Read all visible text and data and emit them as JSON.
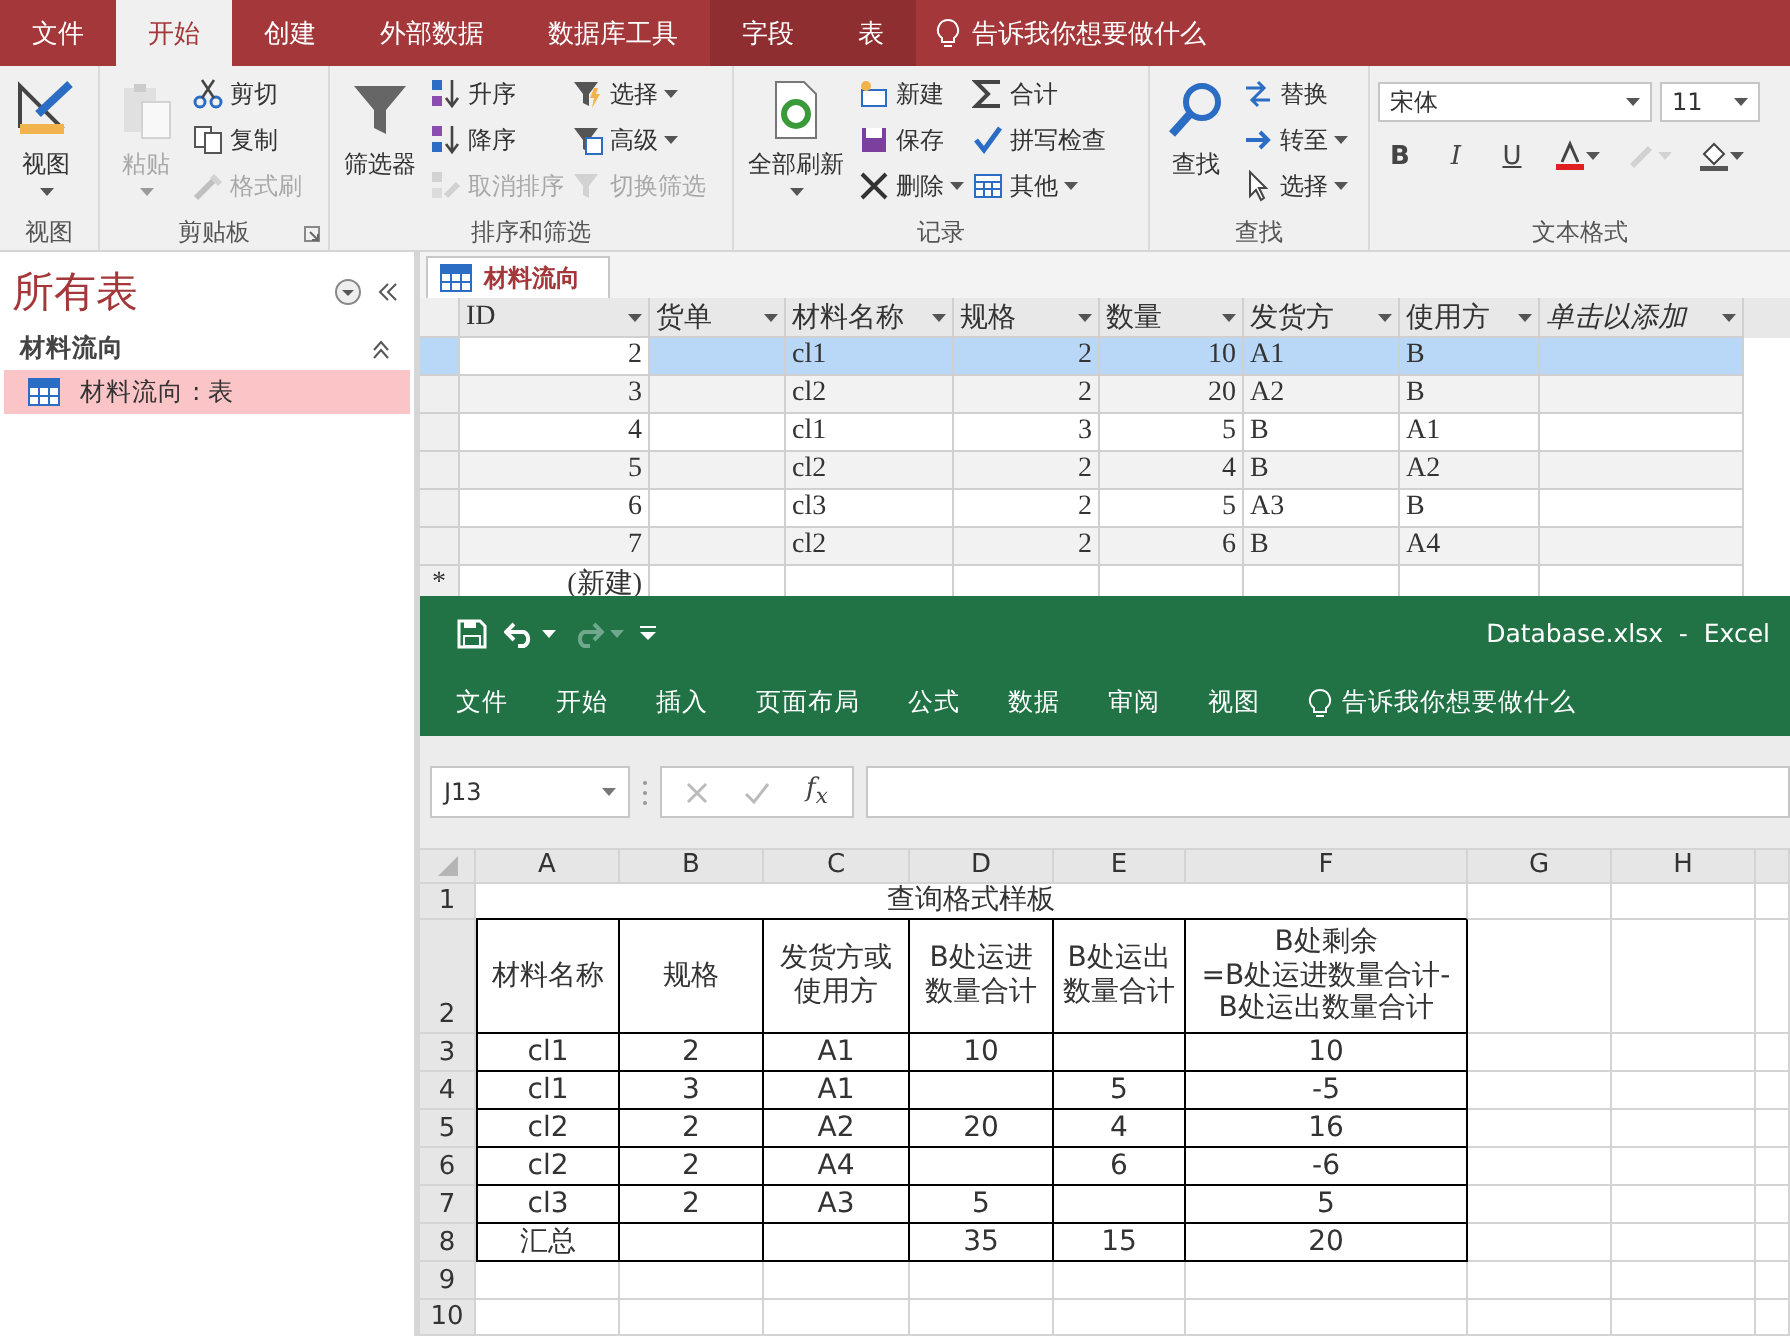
{
  "access": {
    "tabs": [
      {
        "label": "文件",
        "selected": false,
        "contextual": false
      },
      {
        "label": "开始",
        "selected": true,
        "contextual": false
      },
      {
        "label": "创建",
        "selected": false,
        "contextual": false
      },
      {
        "label": "外部数据",
        "selected": false,
        "contextual": false
      },
      {
        "label": "数据库工具",
        "selected": false,
        "contextual": false
      },
      {
        "label": "字段",
        "selected": false,
        "contextual": true
      },
      {
        "label": "表",
        "selected": false,
        "contextual": true
      }
    ],
    "tell_me": "告诉我你想要做什么",
    "ribbon": [
      {
        "label": "视图",
        "launcher": false,
        "columns": [
          [
            {
              "label": "视图",
              "kind": "large",
              "dropdown": true,
              "disabled": false
            }
          ]
        ]
      },
      {
        "label": "剪贴板",
        "launcher": true,
        "columns": [
          [
            {
              "label": "粘贴",
              "kind": "large",
              "dropdown": true,
              "disabled": true
            }
          ],
          [
            {
              "label": "剪切",
              "kind": "small",
              "dropdown": false,
              "disabled": false
            },
            {
              "label": "复制",
              "kind": "small",
              "dropdown": false,
              "disabled": false
            },
            {
              "label": "格式刷",
              "kind": "small",
              "dropdown": false,
              "disabled": true
            }
          ]
        ]
      },
      {
        "label": "排序和筛选",
        "launcher": false,
        "columns": [
          [
            {
              "label": "筛选器",
              "kind": "large",
              "dropdown": false,
              "disabled": false
            }
          ],
          [
            {
              "label": "升序",
              "kind": "small",
              "dropdown": false,
              "disabled": false
            },
            {
              "label": "降序",
              "kind": "small",
              "dropdown": false,
              "disabled": false
            },
            {
              "label": "取消排序",
              "kind": "small",
              "dropdown": false,
              "disabled": true
            }
          ],
          [
            {
              "label": "选择",
              "kind": "small",
              "dropdown": true,
              "disabled": false
            },
            {
              "label": "高级",
              "kind": "small",
              "dropdown": true,
              "disabled": false
            },
            {
              "label": "切换筛选",
              "kind": "small",
              "dropdown": false,
              "disabled": true
            }
          ]
        ]
      },
      {
        "label": "记录",
        "launcher": false,
        "columns": [
          [
            {
              "label": "全部刷新",
              "kind": "large",
              "dropdown": true,
              "disabled": false
            }
          ],
          [
            {
              "label": "新建",
              "kind": "small",
              "dropdown": false,
              "disabled": false
            },
            {
              "label": "保存",
              "kind": "small",
              "dropdown": false,
              "disabled": false
            },
            {
              "label": "删除",
              "kind": "small",
              "dropdown": true,
              "disabled": false
            }
          ],
          [
            {
              "label": "合计",
              "kind": "small",
              "dropdown": false,
              "disabled": false
            },
            {
              "label": "拼写检查",
              "kind": "small",
              "dropdown": false,
              "disabled": false
            },
            {
              "label": "其他",
              "kind": "small",
              "dropdown": true,
              "disabled": false
            }
          ]
        ]
      },
      {
        "label": "查找",
        "launcher": false,
        "columns": [
          [
            {
              "label": "查找",
              "kind": "large",
              "dropdown": false,
              "disabled": false
            }
          ],
          [
            {
              "label": "替换",
              "kind": "small",
              "dropdown": false,
              "disabled": false
            },
            {
              "label": "转至",
              "kind": "small",
              "dropdown": true,
              "disabled": false
            },
            {
              "label": "选择",
              "kind": "small",
              "dropdown": true,
              "disabled": false
            }
          ]
        ]
      }
    ],
    "text_format": {
      "label": "文本格式",
      "font": "宋体",
      "size": "11",
      "style_buttons": [
        {
          "label": "B",
          "kind": "bold"
        },
        {
          "label": "I",
          "kind": "italic"
        },
        {
          "label": "U",
          "kind": "underline"
        }
      ]
    },
    "nav": {
      "title": "所有表",
      "groups": [
        {
          "label": "材料流向",
          "expanded": true,
          "items": [
            {
              "label": "材料流向 : 表",
              "selected": true
            }
          ]
        }
      ]
    },
    "document_tabs": [
      {
        "label": "材料流向",
        "selected": true
      }
    ],
    "datasheet": {
      "columns": [
        {
          "label": "ID",
          "kind": "number"
        },
        {
          "label": "货单",
          "kind": "text"
        },
        {
          "label": "材料名称",
          "kind": "text"
        },
        {
          "label": "规格",
          "kind": "number"
        },
        {
          "label": "数量",
          "kind": "number"
        },
        {
          "label": "发货方",
          "kind": "text"
        },
        {
          "label": "使用方",
          "kind": "text"
        },
        {
          "label": "单击以添加",
          "kind": "add"
        }
      ],
      "rows": [
        {
          "selected": true,
          "cells": [
            "2",
            null,
            "cl1",
            "2",
            "10",
            "A1",
            "B",
            null
          ]
        },
        {
          "selected": false,
          "cells": [
            "3",
            null,
            "cl2",
            "2",
            "20",
            "A2",
            "B",
            null
          ]
        },
        {
          "selected": false,
          "cells": [
            "4",
            null,
            "cl1",
            "3",
            "5",
            "B",
            "A1",
            null
          ]
        },
        {
          "selected": false,
          "cells": [
            "5",
            null,
            "cl2",
            "2",
            "4",
            "B",
            "A2",
            null
          ]
        },
        {
          "selected": false,
          "cells": [
            "6",
            null,
            "cl3",
            "2",
            "5",
            "A3",
            "B",
            null
          ]
        },
        {
          "selected": false,
          "cells": [
            "7",
            null,
            "cl2",
            "2",
            "6",
            "B",
            "A4",
            null
          ]
        }
      ],
      "new_row": {
        "marker": "*",
        "label": "(新建)"
      }
    }
  },
  "excel": {
    "title": "Database.xlsx  -  Excel",
    "tabs": [
      "文件",
      "开始",
      "插入",
      "页面布局",
      "公式",
      "数据",
      "审阅",
      "视图"
    ],
    "tell_me": "告诉我你想要做什么",
    "name_box": "J13",
    "function_label": "f$_{x}$",
    "columns": [
      "A",
      "B",
      "C",
      "D",
      "E",
      "F",
      "G",
      "H"
    ],
    "rows": [
      {
        "number": "1",
        "title": "查询格式样板"
      },
      {
        "number": "2",
        "cells": [
          "材料名称",
          "规格",
          "发货方或使用方",
          "B处运进数量合计",
          "B处运出数量合计",
          "B处剩余\n=B处运进数量合计-\nB处运出数量合计"
        ]
      },
      {
        "number": "3",
        "cells": [
          "cl1",
          "2",
          "A1",
          "10",
          null,
          "10"
        ]
      },
      {
        "number": "4",
        "cells": [
          "cl1",
          "3",
          "A1",
          null,
          "5",
          "-5"
        ]
      },
      {
        "number": "5",
        "cells": [
          "cl2",
          "2",
          "A2",
          "20",
          "4",
          "16"
        ]
      },
      {
        "number": "6",
        "cells": [
          "cl2",
          "2",
          "A4",
          null,
          "6",
          "-6"
        ]
      },
      {
        "number": "7",
        "cells": [
          "cl3",
          "2",
          "A3",
          "5",
          null,
          "5"
        ]
      },
      {
        "number": "8",
        "cells": [
          "汇总",
          null,
          null,
          "35",
          "15",
          "20"
        ]
      },
      {
        "number": "9"
      },
      {
        "number": "10"
      }
    ]
  }
}
